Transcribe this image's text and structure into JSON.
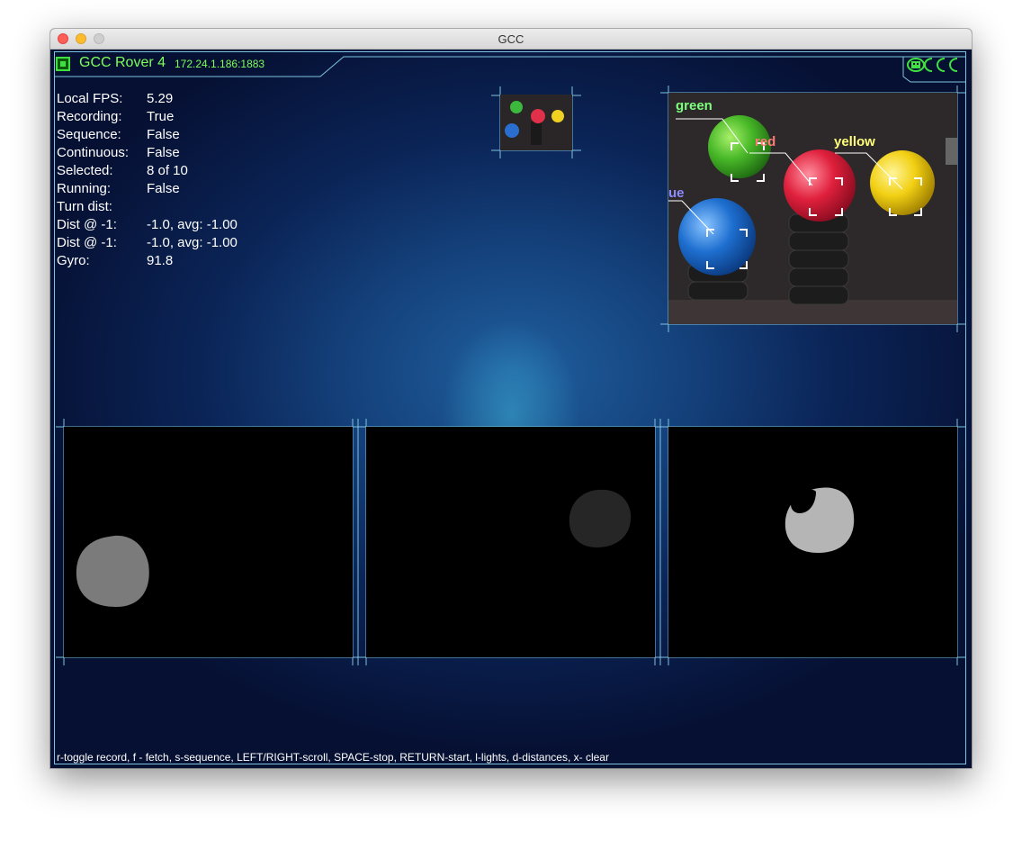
{
  "window": {
    "title": "GCC",
    "controls": [
      "close-button",
      "minimize-button",
      "maximize-button"
    ]
  },
  "header": {
    "status_color": "#3fe03f",
    "title": "GCC Rover 4",
    "address": "172.24.1.186:1883",
    "logo": "GCC"
  },
  "stats": [
    {
      "label": "Local FPS:",
      "value": "5.29"
    },
    {
      "label": "Recording:",
      "value": "True"
    },
    {
      "label": "Sequence:",
      "value": "False"
    },
    {
      "label": "Continuous:",
      "value": "False"
    },
    {
      "label": "Selected:",
      "value": "8 of 10"
    },
    {
      "label": "Running:",
      "value": "False"
    },
    {
      "label": "Turn dist:",
      "value": ""
    },
    {
      "label": "Dist @ -1:",
      "value": "-1.0, avg: -1.00"
    },
    {
      "label": "Dist @ -1:",
      "value": "-1.0, avg: -1.00"
    },
    {
      "label": "Gyro:",
      "value": "91.8"
    }
  ],
  "camera": {
    "labels": {
      "green": {
        "text": "green",
        "color": "#7dff7d"
      },
      "red": {
        "text": "red",
        "color": "#ff7a7a"
      },
      "yellow": {
        "text": "yellow",
        "color": "#ffff7a"
      },
      "blue": {
        "text": "ue",
        "color": "#8c8cff"
      }
    }
  },
  "masks": [
    "mask-panel-1",
    "mask-panel-2",
    "mask-panel-3"
  ],
  "help_text": "r-toggle record, f - fetch, s-sequence, LEFT/RIGHT-scroll, SPACE-stop, RETURN-start, l-lights, d-distances, x- clear",
  "colors": {
    "hud_line": "#7ec3df",
    "text_green": "#7cff5a",
    "background": "#0b2558"
  }
}
